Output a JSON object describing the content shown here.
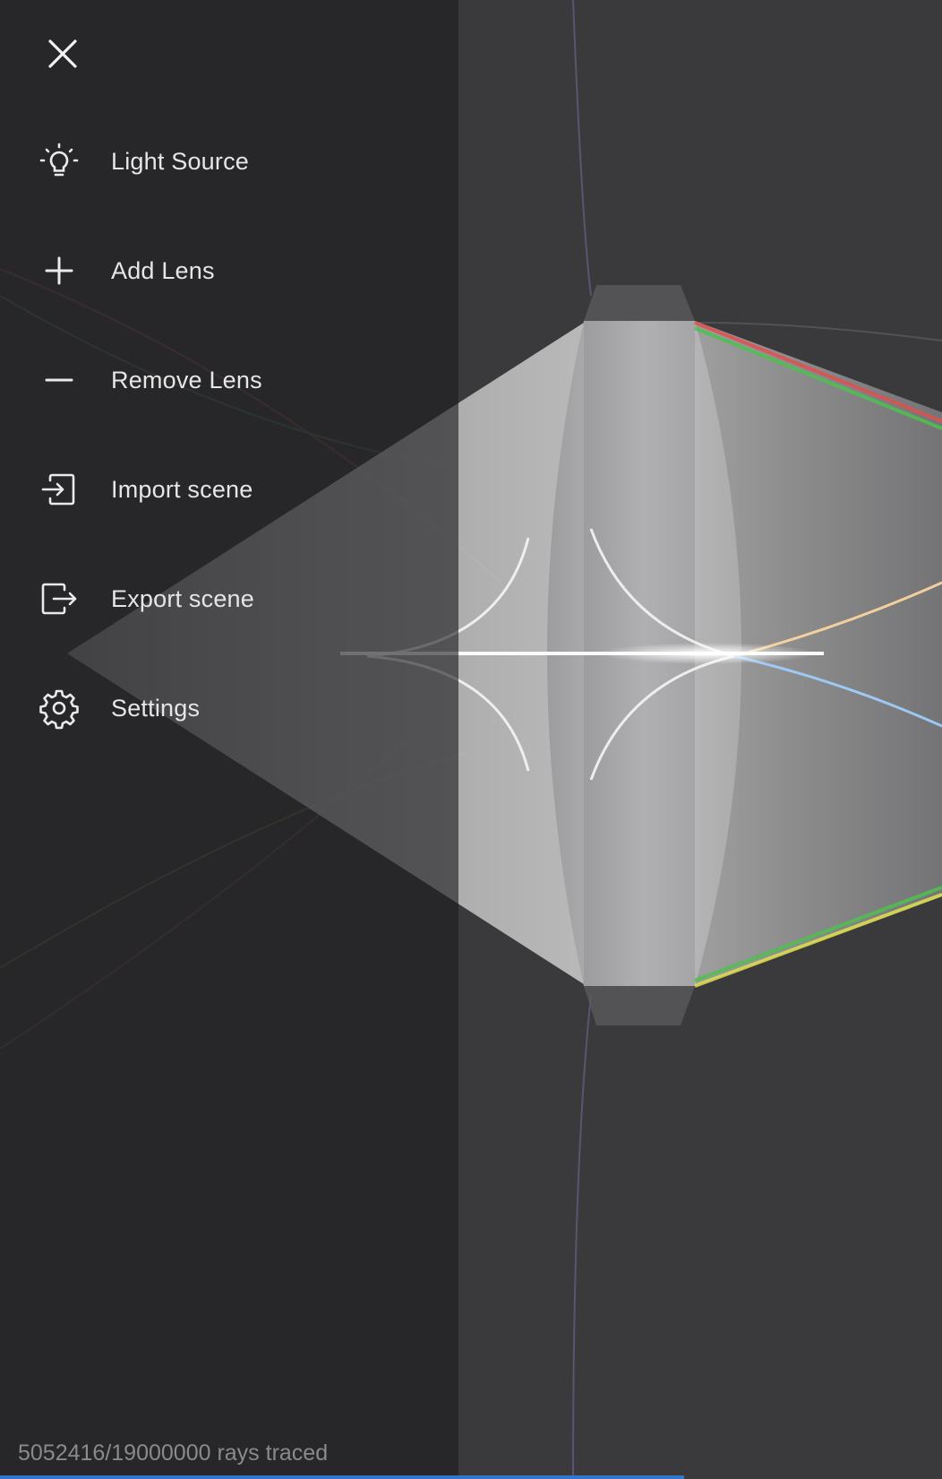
{
  "menu": {
    "close_icon": "close-icon",
    "items": [
      {
        "label": "Light Source",
        "icon": "lightbulb-icon"
      },
      {
        "label": "Add Lens",
        "icon": "plus-icon"
      },
      {
        "label": "Remove Lens",
        "icon": "minus-icon"
      },
      {
        "label": "Import scene",
        "icon": "import-icon"
      },
      {
        "label": "Export scene",
        "icon": "export-icon"
      },
      {
        "label": "Settings",
        "icon": "gear-icon"
      }
    ]
  },
  "status": {
    "rays_traced": 5052416,
    "rays_total": 19000000,
    "text": "5052416/19000000 rays traced"
  },
  "colors": {
    "accent": "#2f77cf",
    "drawer_bg": "#1c1c1e",
    "text": "#e6e6e6"
  }
}
